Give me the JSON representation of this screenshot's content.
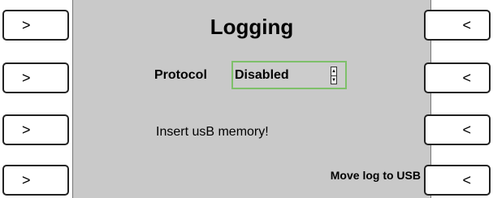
{
  "screen": {
    "title": "Logging",
    "protocol_label": "Protocol",
    "protocol_value": "Disabled",
    "message": "Insert usB memory!",
    "move_log_label": "Move log to USB"
  },
  "left_buttons": [
    ">",
    ">",
    ">",
    ">"
  ],
  "right_buttons": [
    "<",
    "<",
    "<",
    "<"
  ],
  "stepper": {
    "up": "▲",
    "down": "▼"
  },
  "colors": {
    "screen_bg": "#c9c9c9",
    "focus_border": "#7ec06a"
  }
}
